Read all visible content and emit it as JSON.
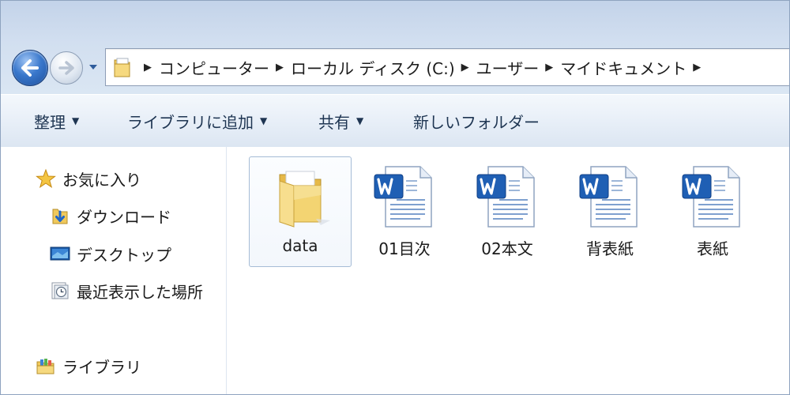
{
  "window": {
    "address_crumbs": [
      "コンピューター",
      "ローカル ディスク (C:)",
      "ユーザー",
      "マイドキュメント"
    ]
  },
  "toolbar": {
    "organize_label": "整理",
    "add_to_library_label": "ライブラリに追加",
    "share_label": "共有",
    "new_folder_label": "新しいフォルダー"
  },
  "sidebar": {
    "favorites_label": "お気に入り",
    "items": [
      {
        "label": "ダウンロード",
        "icon": "download-folder-icon"
      },
      {
        "label": "デスクトップ",
        "icon": "desktop-icon"
      },
      {
        "label": "最近表示した場所",
        "icon": "recent-places-icon"
      }
    ],
    "library_label": "ライブラリ"
  },
  "files": [
    {
      "name": "data",
      "icon": "folder-icon",
      "selected": true
    },
    {
      "name": "01目次",
      "icon": "word-document-icon"
    },
    {
      "name": "02本文",
      "icon": "word-document-icon"
    },
    {
      "name": "背表紙",
      "icon": "word-document-icon"
    },
    {
      "name": "表紙",
      "icon": "word-document-icon"
    }
  ],
  "colors": {
    "word_blue": "#1f5fb4",
    "folder_yellow": "#f3d472",
    "toolbar_text": "#1e3552"
  }
}
